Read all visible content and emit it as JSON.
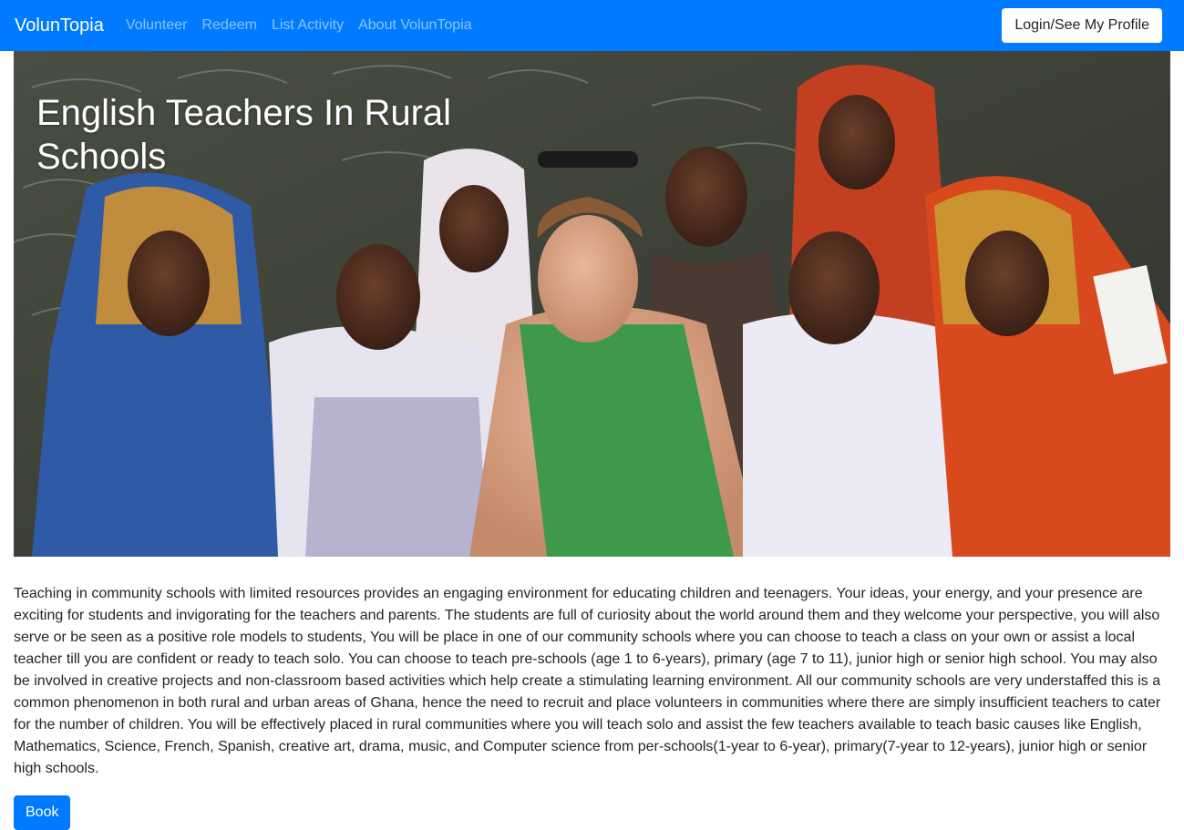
{
  "nav": {
    "brand": "VolunTopia",
    "links": [
      "Volunteer",
      "Redeem",
      "List Activity",
      "About VolunTopia"
    ],
    "login_label": "Login/See My Profile"
  },
  "hero": {
    "title": "English Teachers In Rural Schools",
    "image_alt": "Volunteer teacher with students in a classroom"
  },
  "content": {
    "description": "Teaching in community schools with limited resources provides an engaging environment for educating children and teenagers. Your ideas, your energy, and your presence are exciting for students and invigorating for the teachers and parents. The students are full of curiosity about the world around them and they welcome your perspective, you will also serve or be seen as a positive role models to students, You will be place in one of our community schools where you can choose to teach a class on your own or assist a local teacher till you are confident or ready to teach solo. You can choose to teach pre-schools (age 1 to 6-years), primary (age 7 to 11), junior high or senior high school. You may also be involved in creative projects and non-classroom based activities which help create a stimulating learning environment. All our community schools are very understaffed this is a common phenomenon in both rural and urban areas of Ghana, hence the need to recruit and place volunteers in communities where there are simply insufficient teachers to cater for the number of children. You will be effectively placed in rural communities where you will teach solo and assist the few teachers available to teach basic causes like English, Mathematics, Science, French, Spanish, creative art, drama, music, and Computer science from per-schools(1-year to 6-year), primary(7-year to 12-years), junior high or senior high schools.",
    "book_label": "Book"
  },
  "colors": {
    "primary": "#007bff",
    "navbar_link": "rgba(255,255,255,0.55)",
    "text": "#212529"
  }
}
